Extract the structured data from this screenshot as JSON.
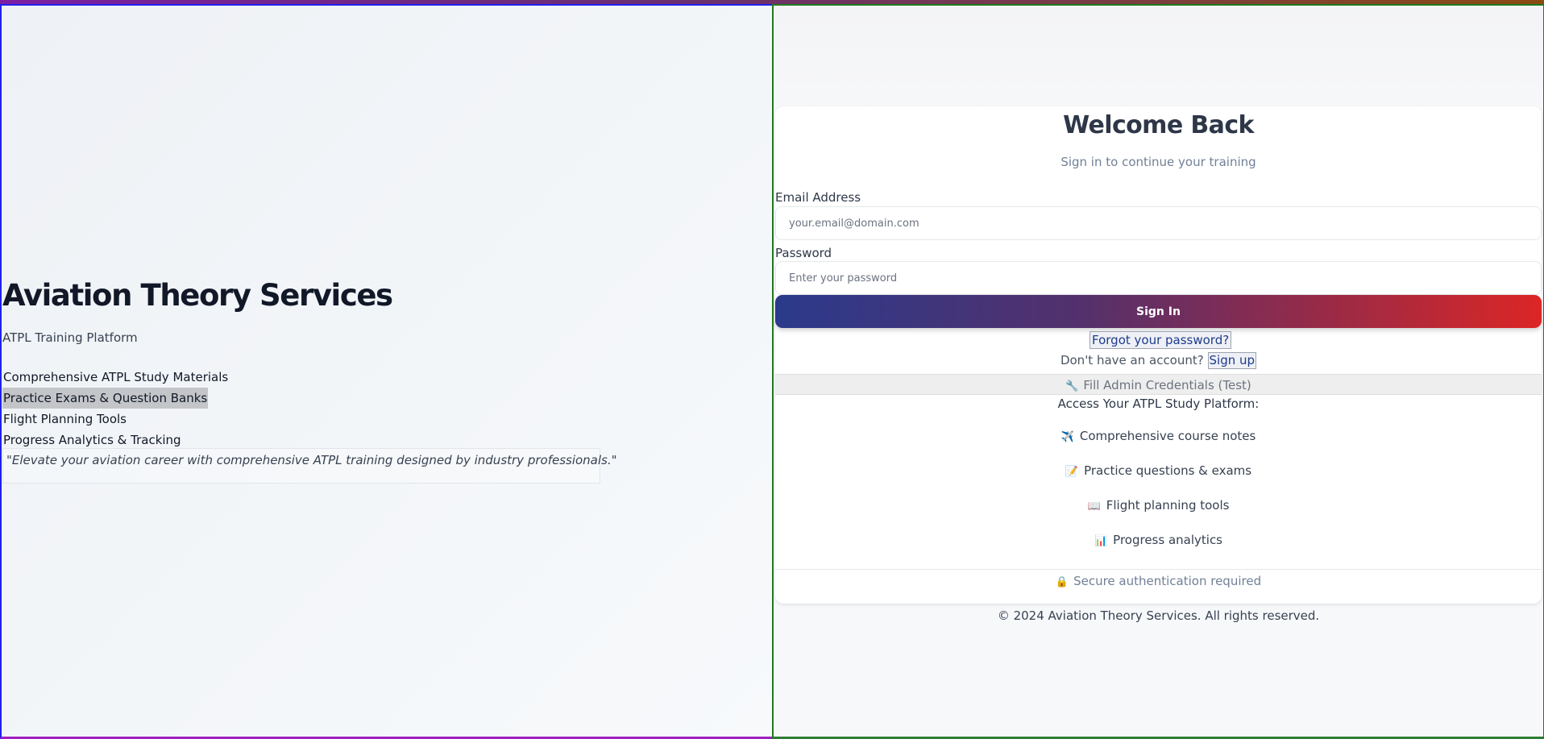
{
  "brand": {
    "title": "Aviation Theory Services",
    "subtitle": "ATPL Training Platform",
    "features": [
      "Comprehensive ATPL Study Materials",
      "Practice Exams & Question Banks",
      "Flight Planning Tools",
      "Progress Analytics & Tracking"
    ],
    "quote": "\"Elevate your aviation career with comprehensive ATPL training designed by industry professionals.\""
  },
  "login": {
    "title": "Welcome Back",
    "subtitle": "Sign in to continue your training",
    "email_label": "Email Address",
    "email_placeholder": "your.email@domain.com",
    "password_label": "Password",
    "password_placeholder": "Enter your password",
    "signin_label": "Sign In",
    "forgot_label": "Forgot your password?",
    "no_account_text": "Don't have an account?",
    "signup_label": "Sign up",
    "admin_fill_label": "Fill Admin Credentials (Test)",
    "access_title": "Access Your ATPL Study Platform:",
    "access_items": [
      {
        "icon": "airplane-icon",
        "label": "Comprehensive course notes"
      },
      {
        "icon": "memo-icon",
        "label": "Practice questions & exams"
      },
      {
        "icon": "book-icon",
        "label": "Flight planning tools"
      },
      {
        "icon": "bar-chart-icon",
        "label": "Progress analytics"
      }
    ],
    "secure_text": "Secure authentication required"
  },
  "footer": {
    "copyright": "© 2024 Aviation Theory Services. All rights reserved."
  },
  "colors": {
    "primary_gradient_start": "#2b3a8c",
    "primary_gradient_end": "#dc2626",
    "heading": "#2d3748",
    "muted": "#718096"
  }
}
